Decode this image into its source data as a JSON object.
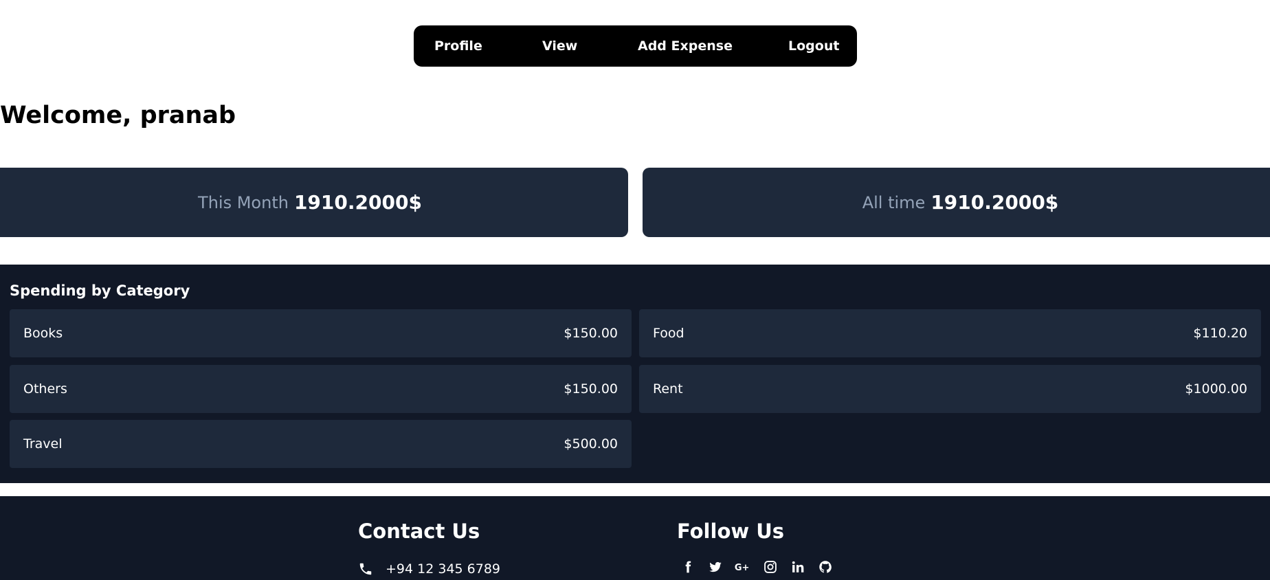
{
  "nav": {
    "items": [
      {
        "label": "Profile"
      },
      {
        "label": "View"
      },
      {
        "label": "Add Expense"
      },
      {
        "label": "Logout"
      }
    ]
  },
  "welcome": {
    "text": "Welcome, pranab"
  },
  "stats": {
    "this_month": {
      "label": "This Month",
      "value": "1910.2000$"
    },
    "all_time": {
      "label": "All time",
      "value": "1910.2000$"
    }
  },
  "spending": {
    "title": "Spending by Category",
    "categories": [
      {
        "name": "Books",
        "amount": "$150.00"
      },
      {
        "name": "Food",
        "amount": "$110.20"
      },
      {
        "name": "Others",
        "amount": "$150.00"
      },
      {
        "name": "Rent",
        "amount": "$1000.00"
      },
      {
        "name": "Travel",
        "amount": "$500.00"
      }
    ]
  },
  "footer": {
    "contact": {
      "title": "Contact Us",
      "phone": "+94 12 345 6789",
      "phone_icon": "phone-icon"
    },
    "follow": {
      "title": "Follow Us",
      "icons": [
        "facebook-icon",
        "twitter-icon",
        "google-plus-icon",
        "instagram-icon",
        "linkedin-icon",
        "github-icon"
      ]
    }
  },
  "colors": {
    "nav_bg": "#000000",
    "card_bg": "#1e293b",
    "panel_bg": "#111827",
    "muted_text": "#94a3b8",
    "text": "#ffffff"
  }
}
